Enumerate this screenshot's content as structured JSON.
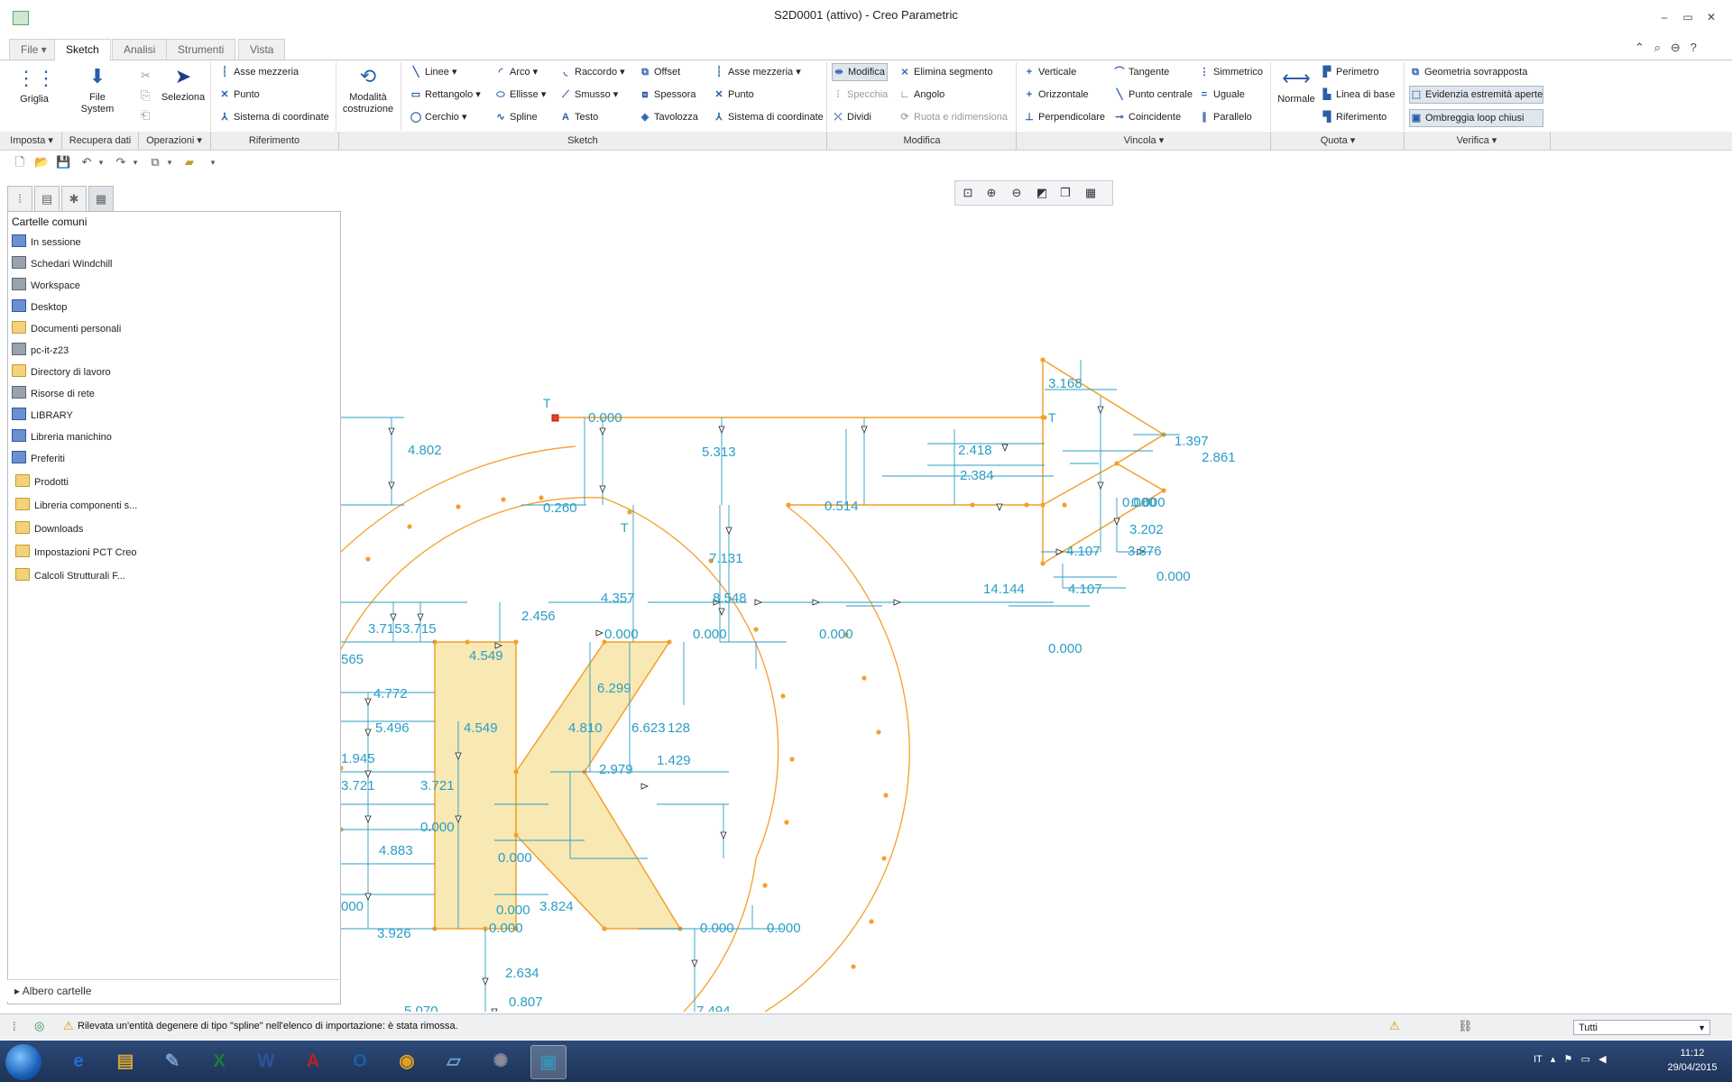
{
  "window": {
    "title": "S2D0001 (attivo) - Creo Parametric",
    "controls": [
      "–",
      "▭",
      "✕"
    ],
    "right_icons": [
      "⌃",
      "⌕",
      "⊖",
      "?"
    ]
  },
  "tabs": [
    {
      "label": "File ▾"
    },
    {
      "label": "Sketch"
    },
    {
      "label": "Analisi"
    },
    {
      "label": "Strumenti"
    },
    {
      "label": "Vista"
    }
  ],
  "ribbon": {
    "griglia": "Griglia",
    "file_system": [
      "File",
      "System"
    ],
    "seleziona": "Seleziona",
    "riferimento_items": [
      "Asse mezzeria",
      "Punto",
      "Sistema di coordinate"
    ],
    "modalita": [
      "Modalità",
      "costruzione"
    ],
    "sketch_col1": [
      "Linee",
      "Rettangolo",
      "Cerchio"
    ],
    "sketch_col2": [
      "Arco",
      "Ellisse",
      "Spline"
    ],
    "sketch_col3": [
      "Raccordo",
      "Smusso",
      "Testo"
    ],
    "sketch_col4": [
      "Offset",
      "Spessora",
      "Tavolozza"
    ],
    "sketch_col5": [
      "Asse mezzeria",
      "Punto",
      "Sistema di coordinate"
    ],
    "modifica_col1": [
      "Modifica",
      "Specchia",
      "Dividi"
    ],
    "modifica_col2": [
      "Elimina segmento",
      "Angolo",
      "Ruota e ridimensiona"
    ],
    "vincola_col1": [
      "Verticale",
      "Orizzontale",
      "Perpendicolare"
    ],
    "vincola_col2": [
      "Tangente",
      "Punto centrale",
      "Coincidente"
    ],
    "vincola_col3": [
      "Simmetrico",
      "Uguale",
      "Parallelo"
    ],
    "normale": "Normale",
    "quota_col": [
      "Perimetro",
      "Linea di base",
      "Riferimento"
    ],
    "verifica_col": [
      "Geometria sovrapposta",
      "Evidenzia estremità aperte",
      "Ombreggia loop chiusi"
    ]
  },
  "groups": [
    "Imposta ▾",
    "Recupera dati",
    "Operazioni ▾",
    "Riferimento",
    "Sketch",
    "Modifica",
    "Vincola ▾",
    "Quota ▾",
    "Verifica ▾"
  ],
  "navigator": {
    "header": "Cartelle comuni",
    "items": [
      {
        "label": "In sessione",
        "icon": "session-icon"
      },
      {
        "label": "Schedari Windchill",
        "icon": "windchill-icon"
      },
      {
        "label": "Workspace",
        "icon": "workspace-icon"
      },
      {
        "label": "Desktop",
        "icon": "desktop-icon"
      },
      {
        "label": "Documenti personali",
        "icon": "documents-icon"
      },
      {
        "label": "pc-it-z23",
        "icon": "computer-icon"
      },
      {
        "label": "Directory di lavoro",
        "icon": "folder-icon"
      },
      {
        "label": "Risorse di rete",
        "icon": "network-icon"
      },
      {
        "label": "LIBRARY",
        "icon": "library-icon"
      },
      {
        "label": "Libreria manichino",
        "icon": "library-icon"
      },
      {
        "label": "Preferiti",
        "icon": "favorites-icon"
      },
      {
        "label": "Prodotti",
        "icon": "folder-icon"
      },
      {
        "label": "Libreria componenti s...",
        "icon": "folder-icon"
      },
      {
        "label": "Downloads",
        "icon": "folder-icon"
      },
      {
        "label": "Impostazioni PCT Creo",
        "icon": "folder-icon"
      },
      {
        "label": "Calcoli Strutturali F...",
        "icon": "folder-icon"
      }
    ],
    "footer": "Albero cartelle"
  },
  "dimensions": [
    "4.802",
    "0.000",
    "5.313",
    "2.418",
    "2.384",
    "3.168",
    "1.397",
    "2.861",
    "0.514",
    "0.000",
    "0.000",
    "3.202",
    "4.107",
    "3.876",
    "0.000",
    "4.107",
    "14.144",
    "0.000",
    "0.260",
    "7.131",
    "4.357",
    "8.548",
    "2.456",
    "0.000",
    "0.000",
    "0.000",
    "3.715",
    "3.715",
    "565",
    "4.549",
    "6.299",
    "4.772",
    "5.496",
    "4.549",
    "4.810",
    "6.623",
    "128",
    "1.945",
    "3.721",
    "3.721",
    "2.979",
    "1.429",
    "0.000",
    "4.883",
    "0.000",
    "3.824",
    "0.000",
    "0.000",
    "0.000",
    "0.000",
    "3.926",
    "2.634",
    "0.807",
    "7.494",
    "000",
    "5.070"
  ],
  "tags": [
    "T",
    "T",
    "T"
  ],
  "status": {
    "message": "Rilevata un'entità degenere di tipo \"spline\" nell'elenco di importazione: è stata rimossa.",
    "filter": "Tutti"
  },
  "taskbar": {
    "apps": [
      {
        "name": "internet-explorer",
        "glyph": "e"
      },
      {
        "name": "file-explorer",
        "glyph": "▤"
      },
      {
        "name": "paint",
        "glyph": "✎"
      },
      {
        "name": "excel",
        "glyph": "X"
      },
      {
        "name": "word",
        "glyph": "W"
      },
      {
        "name": "acrobat",
        "glyph": "A"
      },
      {
        "name": "outlook",
        "glyph": "O"
      },
      {
        "name": "chrome",
        "glyph": "◉"
      },
      {
        "name": "notes",
        "glyph": "▱"
      },
      {
        "name": "tool",
        "glyph": "✺"
      },
      {
        "name": "creo",
        "glyph": "▣"
      }
    ],
    "lang": "IT",
    "time": "11:12",
    "date": "29/04/2015"
  },
  "colors": {
    "sketch": "#f3a02b",
    "dimension": "#2a9ec4",
    "fill": "#f8e8b4",
    "accent": "#2a5fa8"
  }
}
